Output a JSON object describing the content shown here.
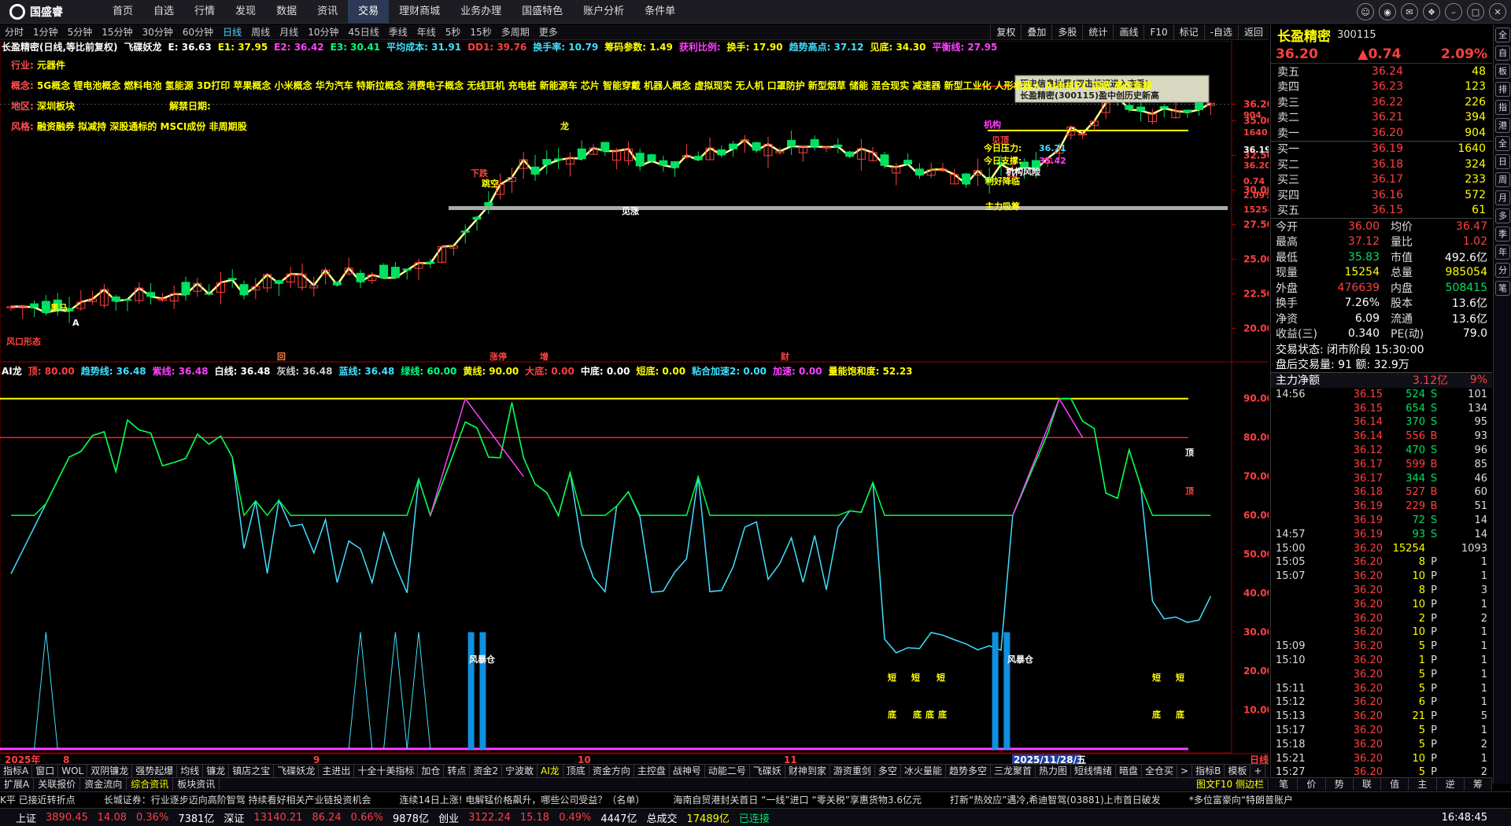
{
  "app": {
    "name": "国盛睿"
  },
  "menu": [
    "首页",
    "自选",
    "行情",
    "发现",
    "数据",
    "资讯",
    "交易",
    "理财商城",
    "业务办理",
    "国盛特色",
    "账户分析",
    "条件单"
  ],
  "menu_active": 6,
  "win_icons": [
    "chat-icon",
    "user-icon",
    "mail-icon",
    "skin-icon",
    "minimize-icon",
    "maximize-icon",
    "close-icon"
  ],
  "periods": [
    "分时",
    "1分钟",
    "5分钟",
    "15分钟",
    "30分钟",
    "60分钟",
    "日线",
    "周线",
    "月线",
    "10分钟",
    "45日线",
    "季线",
    "年线",
    "5秒",
    "15秒",
    "多周期",
    "更多"
  ],
  "period_active": 6,
  "tools": [
    "复权",
    "叠加",
    "多股",
    "统计",
    "画线",
    "F10",
    "标记",
    "-自选",
    "返回"
  ],
  "legend_main": [
    {
      "t": "长盈精密(日线,等比前复权)",
      "c": "#ffffff"
    },
    {
      "t": "飞碟妖龙",
      "c": "#ffffff"
    },
    {
      "t": "E: 36.63",
      "c": "#ffffff"
    },
    {
      "t": "E1: 37.95",
      "c": "#ffff00"
    },
    {
      "t": "E2: 36.42",
      "c": "#ff40ff"
    },
    {
      "t": "E3: 30.41",
      "c": "#00ff80"
    },
    {
      "t": "平均成本: 31.91",
      "c": "#40e0ff"
    },
    {
      "t": "DD1: 39.76",
      "c": "#ff4040"
    },
    {
      "t": "换手率: 10.79",
      "c": "#40e0ff"
    },
    {
      "t": "筹码参数: 1.49",
      "c": "#ffff00"
    },
    {
      "t": "获利比例:",
      "c": "#ff40ff"
    },
    {
      "t": "换手: 17.90",
      "c": "#ffff00"
    },
    {
      "t": "趋势高点: 37.12",
      "c": "#40e0ff"
    },
    {
      "t": "见底: 34.30",
      "c": "#ffff00"
    },
    {
      "t": "平衡线: 27.95",
      "c": "#ff40ff"
    }
  ],
  "info": {
    "industry_k": "行业:",
    "industry_v": "元器件",
    "concept_k": "概念:",
    "concept_v": "5G概念 锂电池概念 燃料电池 氢能源 3D打印 苹果概念 小米概念 华为汽车 特斯拉概念 消费电子概念 无线耳机 充电桩 新能源车 芯片 智能穿戴 机器人概念 虚拟现实 无人机 口罩防护 新型烟草 储能 混合现实 减速器 新型工业化 人形机器人 AI手机PC 国资 高速连接",
    "region_k": "地区:",
    "region_v": "深圳板块",
    "ban_k": "解禁日期:",
    "style_k": "风格:",
    "style_v": "融资融券 拟减持 深股通标的 MSCI成份 非周期股"
  },
  "tooltip": [
    "历史信息地雷(双击标记进入查看)",
    "长盈精密(300115)盈中创历史新高"
  ],
  "main_marks": [
    "今日压力:",
    "36.71",
    "今日支撑:",
    "35.42",
    "机构",
    "主力吸筹",
    "风口形态",
    "黑马",
    "龙",
    "下跌",
    "见涨",
    "跳空",
    "见顶",
    "机构风险",
    "利好降临",
    "A"
  ],
  "y_main": [
    "36.20",
    "35.00",
    "32.50",
    "30.00",
    "27.50",
    "25.00",
    "22.50",
    "20.00"
  ],
  "y_main_side": [
    "904",
    "1640",
    "36.19",
    "36.20",
    "0.74",
    "2.09%",
    "15254"
  ],
  "events": [
    "回",
    "涨停",
    "增",
    "财"
  ],
  "legend_sub": [
    {
      "t": "AI龙",
      "c": "#ffffff"
    },
    {
      "t": "顶: 80.00",
      "c": "#ff4040"
    },
    {
      "t": "趋势线: 36.48",
      "c": "#40e0ff"
    },
    {
      "t": "紫线: 36.48",
      "c": "#ff40ff"
    },
    {
      "t": "白线: 36.48",
      "c": "#ffffff"
    },
    {
      "t": "灰线: 36.48",
      "c": "#cccccc"
    },
    {
      "t": "蓝线: 36.48",
      "c": "#40e0ff"
    },
    {
      "t": "绿线: 60.00",
      "c": "#00ff80"
    },
    {
      "t": "黄线: 90.00",
      "c": "#ffff00"
    },
    {
      "t": "大底: 0.00",
      "c": "#ff4040"
    },
    {
      "t": "中底: 0.00",
      "c": "#ffffff"
    },
    {
      "t": "短底: 0.00",
      "c": "#ffff00"
    },
    {
      "t": "粘合加速2: 0.00",
      "c": "#40e0ff"
    },
    {
      "t": "加速: 0.00",
      "c": "#ff40ff"
    },
    {
      "t": "量能饱和度: 52.23",
      "c": "#ffff00"
    }
  ],
  "y_sub": [
    "90.00",
    "80.00",
    "70.00",
    "60.00",
    "50.00",
    "40.00",
    "30.00",
    "20.00",
    "10.00"
  ],
  "sub_marks": [
    "顶",
    "顶",
    "风暴仓",
    "风暴仓",
    "短",
    "短",
    "短",
    "短",
    "短",
    "底",
    "底",
    "底",
    "底",
    "底",
    "底"
  ],
  "x_axis": [
    "2025年",
    "8",
    "9",
    "10",
    "11",
    "2025/11/28/五",
    "日线"
  ],
  "quote": {
    "name": "长盈精密",
    "code": "300115",
    "price": "36.20",
    "change": "▲0.74",
    "pct": "2.09%",
    "asks": [
      [
        "卖五",
        "36.24",
        "48"
      ],
      [
        "卖四",
        "36.23",
        "123"
      ],
      [
        "卖三",
        "36.22",
        "226"
      ],
      [
        "卖二",
        "36.21",
        "394"
      ],
      [
        "卖一",
        "36.20",
        "904"
      ]
    ],
    "bids": [
      [
        "买一",
        "36.19",
        "1640"
      ],
      [
        "买二",
        "36.18",
        "324"
      ],
      [
        "买三",
        "36.17",
        "233"
      ],
      [
        "买四",
        "36.16",
        "572"
      ],
      [
        "买五",
        "36.15",
        "61"
      ]
    ],
    "stats": [
      [
        "今开",
        "36.00",
        "均价",
        "36.47"
      ],
      [
        "最高",
        "37.12",
        "量比",
        "1.02"
      ],
      [
        "最低",
        "35.83",
        "市值",
        "492.6亿"
      ],
      [
        "现量",
        "15254",
        "总量",
        "985054"
      ],
      [
        "外盘",
        "476639",
        "内盘",
        "508415"
      ],
      [
        "换手",
        "7.26%",
        "股本",
        "13.6亿"
      ],
      [
        "净资",
        "6.09",
        "流通",
        "13.6亿"
      ],
      [
        "收益(三)",
        "0.340",
        "PE(动)",
        "79.0"
      ]
    ],
    "trade_status": "交易状态: 闭市阶段 15:30:00",
    "after": "盘后交易量: 91  额: 32.9万",
    "netflow_label": "主力净额",
    "netflow": "3.12亿",
    "netflow_pct": "9%"
  },
  "ticks": [
    [
      "14:56",
      "36.15",
      "524",
      "S",
      "101"
    ],
    [
      "",
      "36.15",
      "654",
      "S",
      "134"
    ],
    [
      "",
      "36.14",
      "370",
      "S",
      "95"
    ],
    [
      "",
      "36.14",
      "556",
      "B",
      "93"
    ],
    [
      "",
      "36.12",
      "470",
      "S",
      "96"
    ],
    [
      "",
      "36.17",
      "599",
      "B",
      "85"
    ],
    [
      "",
      "36.17",
      "344",
      "S",
      "46"
    ],
    [
      "",
      "36.18",
      "527",
      "B",
      "60"
    ],
    [
      "",
      "36.19",
      "229",
      "B",
      "51"
    ],
    [
      "",
      "36.19",
      "72",
      "S",
      "14"
    ],
    [
      "14:57",
      "36.19",
      "93",
      "S",
      "14"
    ],
    [
      "15:00",
      "36.20",
      "15254",
      "",
      "1093"
    ],
    [
      "15:05",
      "36.20",
      "8",
      "P",
      "1"
    ],
    [
      "15:07",
      "36.20",
      "10",
      "P",
      "1"
    ],
    [
      "",
      "36.20",
      "8",
      "P",
      "3"
    ],
    [
      "",
      "36.20",
      "10",
      "P",
      "1"
    ],
    [
      "",
      "36.20",
      "2",
      "P",
      "2"
    ],
    [
      "",
      "36.20",
      "10",
      "P",
      "1"
    ],
    [
      "15:09",
      "36.20",
      "5",
      "P",
      "1"
    ],
    [
      "15:10",
      "36.20",
      "1",
      "P",
      "1"
    ],
    [
      "",
      "36.20",
      "5",
      "P",
      "1"
    ],
    [
      "15:11",
      "36.20",
      "5",
      "P",
      "1"
    ],
    [
      "15:12",
      "36.20",
      "6",
      "P",
      "1"
    ],
    [
      "15:13",
      "36.20",
      "21",
      "P",
      "5"
    ],
    [
      "15:17",
      "36.20",
      "5",
      "P",
      "1"
    ],
    [
      "15:18",
      "36.20",
      "5",
      "P",
      "2"
    ],
    [
      "15:21",
      "36.20",
      "10",
      "P",
      "1"
    ],
    [
      "15:27",
      "36.20",
      "5",
      "P",
      "2"
    ]
  ],
  "side_icons": [
    "全",
    "自",
    "板",
    "排",
    "指",
    "港",
    "全",
    "日",
    "周",
    "月",
    "多",
    "季",
    "年",
    "分",
    "笔"
  ],
  "tabs1": [
    "指标A",
    "窗口",
    "WOL",
    "双阴镰龙",
    "强势起爆",
    "均线",
    "镰龙",
    "镇店之宝",
    "飞碟妖龙",
    "主进出",
    "十全十美指标",
    "加仓",
    "转点",
    "资金2",
    "宁波敢",
    "AI龙",
    "顶底",
    "资金方向",
    "主控盘",
    "战神号",
    "动能二号",
    "飞碟妖",
    "财神到家",
    "游资重剑",
    "多空",
    "冰火量能",
    "趋势多空",
    "三龙聚首",
    "热力图",
    "短线情绪",
    "暗盘",
    "全仓买",
    ">",
    "指标B",
    "模板",
    "+",
    "-"
  ],
  "tabs1_active": 15,
  "tabs2": [
    "扩展A",
    "关联报价",
    "资金流向",
    "综合资讯",
    "板块资讯"
  ],
  "tabs2_active": 3,
  "tabs2_right": "图文F10 侧边栏",
  "rp_tabs": [
    "笔",
    "价",
    "势",
    "联",
    "值",
    "主",
    "逆",
    "筹"
  ],
  "news": [
    "K平 已接近转折点",
    "长城证券：行业逐步迈向高阶智驾 持续看好相关产业链投资机会",
    "连续14日上涨! 电解锰价格飙升，哪些公司受益？（名单）",
    "海南自贸港封关首日 “一线”进口 “零关税”享惠货物3.6亿元",
    "打新“热效应”遇冷,希迪智驾(03881)上市首日破发",
    "*多位富豪向“特朗普账户"
  ],
  "status": {
    "sh_label": "上证",
    "sh": "3890.45",
    "sh_chg": "14.08",
    "sh_pct": "0.36%",
    "sh_amt": "7381亿",
    "sz_label": "深证",
    "sz": "13140.21",
    "sz_chg": "86.24",
    "sz_pct": "0.66%",
    "sz_amt": "9878亿",
    "cy_label": "创业",
    "cy": "3122.24",
    "cy_chg": "15.18",
    "cy_pct": "0.49%",
    "cy_amt": "4447亿",
    "total_label": "总成交",
    "total": "17489亿",
    "conn": "已连接",
    "time": "16:48:45"
  },
  "colors": {
    "up": "#ff4040",
    "down": "#00e060",
    "ma_yellow": "#ffff00",
    "ma_white": "#ffffff",
    "ma_magenta": "#c020c0",
    "ma_cyan": "#20d0e0",
    "ma_green": "#20e040",
    "ma_purple": "#8030ff",
    "ma_red": "#ff2020"
  }
}
